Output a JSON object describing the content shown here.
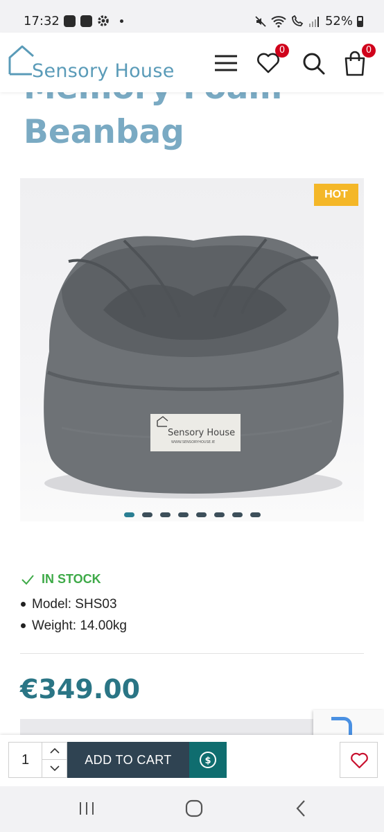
{
  "status_bar": {
    "time": "17:32",
    "battery": "52%",
    "left_icons": [
      "app-icon",
      "gallery-icon",
      "settings-icon",
      "dot-icon"
    ],
    "right_icons": [
      "mute-icon",
      "wifi-icon",
      "wifi-call-icon",
      "signal-icon",
      "battery-icon"
    ]
  },
  "header": {
    "logo_text": "Sensory House",
    "wishlist_count": "0",
    "cart_count": "0",
    "brand_color": "#5a9bb8",
    "badge_color": "#d0021b"
  },
  "product": {
    "title_line1": "Memory Foam",
    "title_line2": "Beanbag",
    "badge": "HOT",
    "image_label": "Sensory House",
    "image_label_url": "WWW.SENSORYHOUSE.IE",
    "gallery_dots": 8,
    "gallery_active": 0,
    "stock": "IN STOCK",
    "model": "Model: SHS03",
    "weight": "Weight: 14.00kg",
    "price": "€349.00",
    "price_color": "#2a7585",
    "stock_color": "#3eaa48"
  },
  "cart_bar": {
    "quantity": "1",
    "add_to_cart": "ADD TO CART"
  },
  "colors": {
    "title": "#7aaac3",
    "cart_button": "#2f4352",
    "pay_button": "#0f6d6f",
    "hot_badge": "#f4b728"
  }
}
